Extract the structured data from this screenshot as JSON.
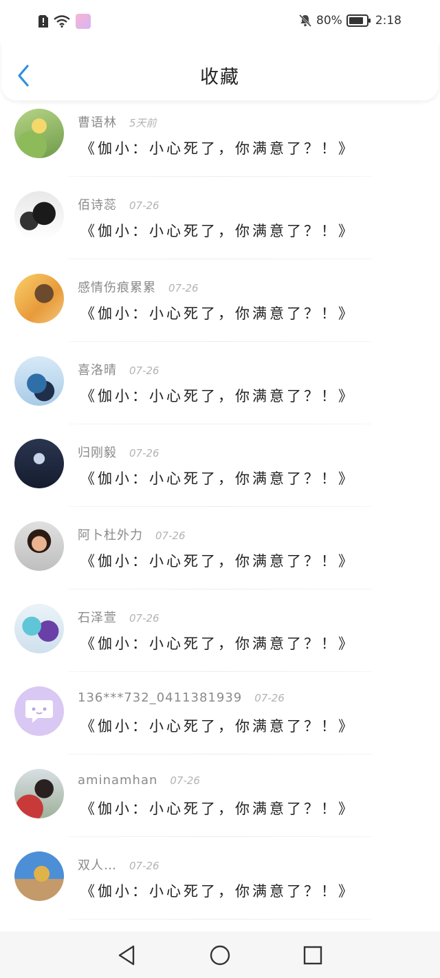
{
  "status_bar": {
    "battery_text": "80%",
    "time": "2:18",
    "icons": [
      "alert-icon",
      "wifi-icon",
      "app-icon",
      "mute-bell-icon",
      "battery-icon"
    ]
  },
  "header": {
    "title": "收藏",
    "back_icon": "chevron-left-icon"
  },
  "favorites": [
    {
      "name": "曹语林",
      "time": "5天前",
      "content": "《伽小：小心死了，你满意了？！》"
    },
    {
      "name": "佰诗蕊",
      "time": "07-26",
      "content": "《伽小：小心死了，你满意了？！》"
    },
    {
      "name": "感情伤痕累累",
      "time": "07-26",
      "content": "《伽小：小心死了，你满意了？！》"
    },
    {
      "name": "喜洛晴",
      "time": "07-26",
      "content": "《伽小：小心死了，你满意了？！》"
    },
    {
      "name": "归刚毅",
      "time": "07-26",
      "content": "《伽小：小心死了，你满意了？！》"
    },
    {
      "name": "阿卜杜外力",
      "time": "07-26",
      "content": "《伽小：小心死了，你满意了？！》"
    },
    {
      "name": "石泽萱",
      "time": "07-26",
      "content": "《伽小：小心死了，你满意了？！》"
    },
    {
      "name": "136***732_0411381939",
      "time": "07-26",
      "content": "《伽小：小心死了，你满意了？！》"
    },
    {
      "name": "aminamhan",
      "time": "07-26",
      "content": "《伽小：小心死了，你满意了？！》"
    },
    {
      "name": "双人…",
      "time": "07-26",
      "content": "《伽小：小心死了，你满意了？！》"
    }
  ],
  "nav_bar": {
    "icons": [
      "back-triangle-icon",
      "home-circle-icon",
      "recents-square-icon"
    ]
  },
  "colors": {
    "accent": "#2f8fe0",
    "name_gray": "#8a8a8a",
    "time_gray": "#b3b3b3",
    "default_avatar": "#d9c8f3"
  }
}
